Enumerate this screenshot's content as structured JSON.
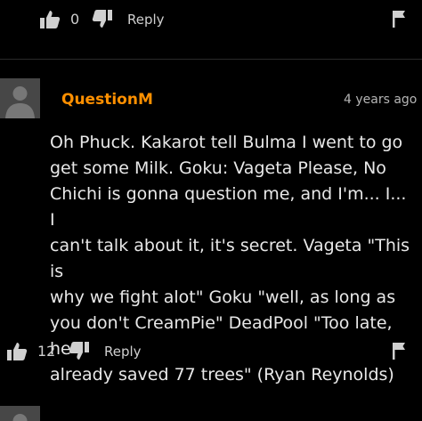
{
  "top_comment_actions": {
    "like_count": "0",
    "reply_label": "Reply"
  },
  "comment": {
    "username": "QuestionM",
    "timestamp": "4 years ago",
    "lines": [
      "Oh Phuck. Kakarot tell Bulma I went to go",
      "get some Milk. Goku: Vageta Please, No",
      "Chichi is gonna question me, and I'm... I... I",
      "can't talk about it, it's secret. Vageta \"This is",
      "why we fight alot\" Goku \"well, as long as",
      "you don't CreamPie\" DeadPool \"Too late, he",
      "already saved 77 trees\" (Ryan Reynolds)"
    ],
    "like_count": "12",
    "reply_label": "Reply"
  },
  "colors": {
    "username": "#ff9000",
    "background": "#000000"
  },
  "icons": {
    "thumbs_up": "thumbs-up-icon",
    "thumbs_down": "thumbs-down-icon",
    "flag": "flag-icon",
    "avatar": "avatar-placeholder-icon"
  }
}
